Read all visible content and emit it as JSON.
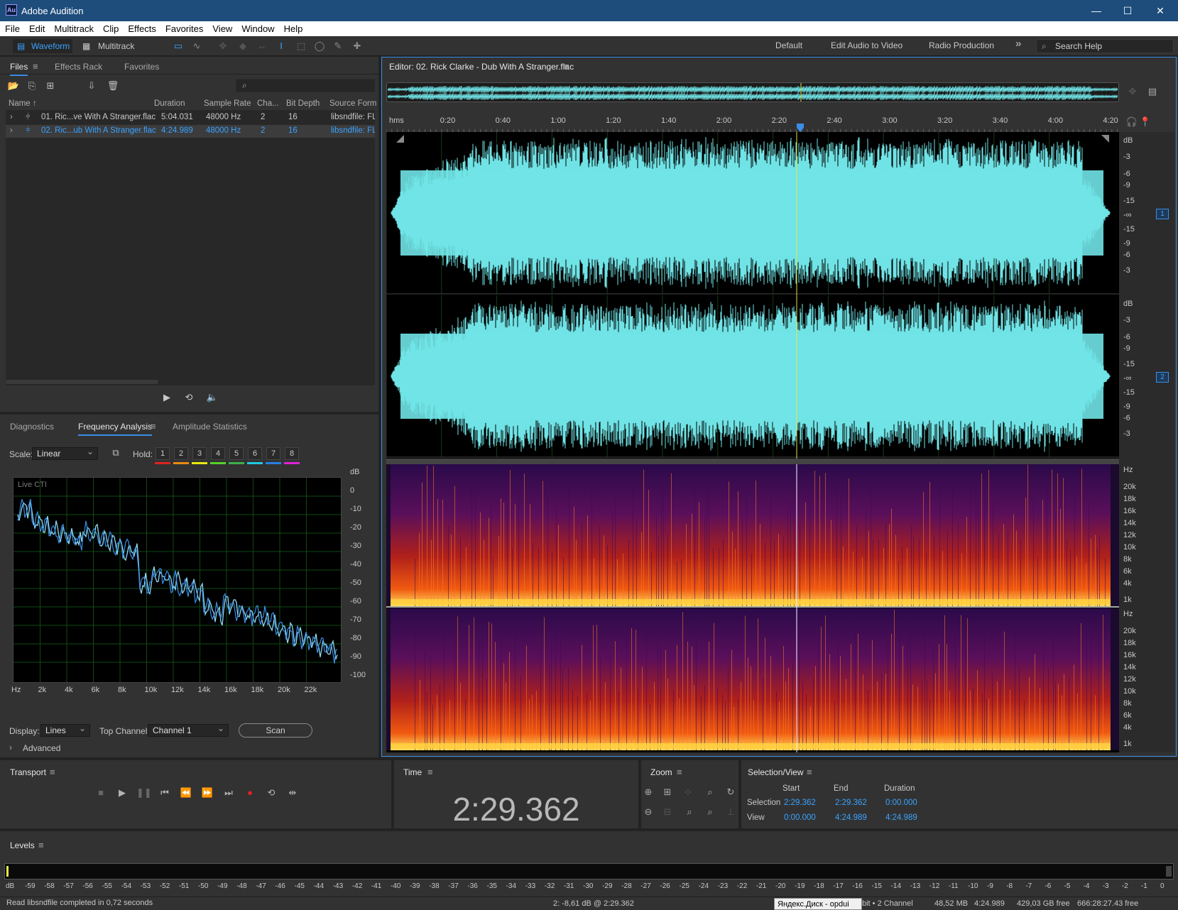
{
  "app": {
    "title": "Adobe Audition",
    "logo": "Au"
  },
  "window_controls": {
    "minimize": "—",
    "maximize": "☐",
    "close": "✕"
  },
  "menu": [
    "File",
    "Edit",
    "Multitrack",
    "Clip",
    "Effects",
    "Favorites",
    "View",
    "Window",
    "Help"
  ],
  "toolbar": {
    "waveform_label": "Waveform",
    "multitrack_label": "Multitrack"
  },
  "workspaces": [
    "Default",
    "Edit Audio to Video",
    "Radio Production"
  ],
  "workspace_more": "»",
  "search": {
    "placeholder": "Search Help"
  },
  "files_panel": {
    "tabs": [
      "Files",
      "Effects Rack",
      "Favorites"
    ],
    "active_tab": "Files",
    "columns": [
      "Name ↑",
      "Duration",
      "Sample Rate",
      "Cha...",
      "Bit Depth",
      "Source Form..."
    ],
    "rows": [
      {
        "name": "01. Ric...ve With A Stranger.flac",
        "duration": "5:04.031",
        "sample_rate": "48000 Hz",
        "channels": "2",
        "bit_depth": "16",
        "source": "libsndfile: FL",
        "selected": false
      },
      {
        "name": "02. Ric...ub With A Stranger.flac",
        "duration": "4:24.989",
        "sample_rate": "48000 Hz",
        "channels": "2",
        "bit_depth": "16",
        "source": "libsndfile: FL",
        "selected": true
      }
    ]
  },
  "analysis_panel": {
    "tabs": [
      "Diagnostics",
      "Frequency Analysis",
      "Amplitude Statistics"
    ],
    "active_tab": "Frequency Analysis",
    "scale_label": "Scale:",
    "scale_value": "Linear",
    "hold_label": "Hold:",
    "hold_buttons": [
      "1",
      "2",
      "3",
      "4",
      "5",
      "6",
      "7",
      "8"
    ],
    "hold_colors": [
      "#e0221f",
      "#e88a12",
      "#e8e812",
      "#54d22a",
      "#3cb04a",
      "#22c8e0",
      "#2a7ee6",
      "#e022d6"
    ],
    "graph_label": "Live CTI",
    "db_axis": [
      "dB",
      "0",
      "-10",
      "-20",
      "-30",
      "-40",
      "-50",
      "-60",
      "-70",
      "-80",
      "-90",
      "-100"
    ],
    "hz_axis": [
      "Hz",
      "2k",
      "4k",
      "6k",
      "8k",
      "10k",
      "12k",
      "14k",
      "16k",
      "18k",
      "20k",
      "22k"
    ],
    "display_label": "Display:",
    "display_value": "Lines",
    "top_channel_label": "Top Channel:",
    "top_channel_value": "Channel 1",
    "scan_label": "Scan",
    "advanced_label": "Advanced"
  },
  "editor": {
    "title": "Editor: 02. Rick Clarke - Dub With A Stranger.flac",
    "timeline_labels": [
      "hms",
      "0:20",
      "0:40",
      "1:00",
      "1:20",
      "1:40",
      "2:00",
      "2:20",
      "2:40",
      "3:00",
      "3:20",
      "3:40",
      "4:00",
      "4:20"
    ],
    "db_scale": [
      "dB",
      "-3",
      "-6",
      "-9",
      "-15",
      "-∞",
      "-15",
      "-9",
      "-6",
      "-3"
    ],
    "hz_scale": [
      "Hz",
      "20k",
      "18k",
      "16k",
      "14k",
      "12k",
      "10k",
      "8k",
      "6k",
      "4k",
      "1k"
    ],
    "channel_badges": [
      "1",
      "2"
    ],
    "waveform_color": "#70e3e6",
    "playhead_color": "#e6e64a"
  },
  "transport": {
    "title": "Transport"
  },
  "time_panel": {
    "title": "Time",
    "value": "2:29.362"
  },
  "zoom_panel": {
    "title": "Zoom"
  },
  "selection_view": {
    "title": "Selection/View",
    "headers": [
      "Start",
      "End",
      "Duration"
    ],
    "selection_label": "Selection",
    "view_label": "View",
    "selection": [
      "2:29.362",
      "2:29.362",
      "0:00.000"
    ],
    "view": [
      "0:00.000",
      "4:24.989",
      "4:24.989"
    ]
  },
  "levels": {
    "title": "Levels",
    "scale": [
      "dB",
      "-59",
      "-58",
      "-57",
      "-56",
      "-55",
      "-54",
      "-53",
      "-52",
      "-51",
      "-50",
      "-49",
      "-48",
      "-47",
      "-46",
      "-45",
      "-44",
      "-43",
      "-42",
      "-41",
      "-40",
      "-39",
      "-38",
      "-37",
      "-36",
      "-35",
      "-34",
      "-33",
      "-32",
      "-31",
      "-30",
      "-29",
      "-28",
      "-27",
      "-26",
      "-25",
      "-24",
      "-23",
      "-22",
      "-21",
      "-20",
      "-19",
      "-18",
      "-17",
      "-16",
      "-15",
      "-14",
      "-13",
      "-12",
      "-11",
      "-10",
      "-9",
      "-8",
      "-7",
      "-6",
      "-5",
      "-4",
      "-3",
      "-2",
      "-1",
      "0"
    ]
  },
  "status": {
    "left": "Read libsndfile completed in 0,72 seconds",
    "cursor": "2: -8,61 dB @ 2:29.362",
    "tooltip": "Яндекс.Диск - opdui",
    "format": "bit • 2 Channel",
    "size": "48,52 MB",
    "duration": "4:24.989",
    "free": "429,03 GB free",
    "free_time": "666:28:27.43 free"
  }
}
